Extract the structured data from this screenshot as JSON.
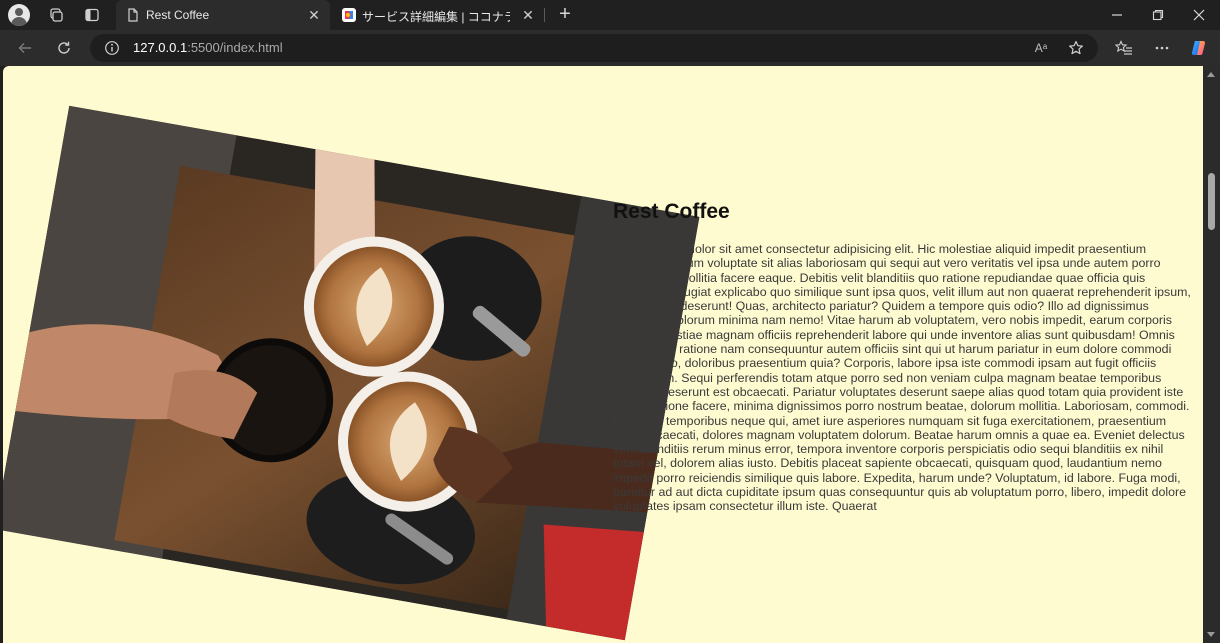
{
  "tabs": [
    {
      "title": "Rest Coffee",
      "active": true
    },
    {
      "title": "サービス詳細編集 | ココナラ",
      "active": false
    }
  ],
  "address_bar": {
    "host": "127.0.0.1",
    "path": ":5500/index.html",
    "read_aloud_label": "Aᵃ"
  },
  "page": {
    "heading": "Rest Coffee",
    "body": "Lorem ipsum dolor sit amet consectetur adipisicing elit. Hic molestiae aliquid impedit praesentium voluptatum, cum voluptate sit alias laboriosam qui sequi aut vero veritatis vel ipsa unde autem porro quam quod mollitia facere eaque. Debitis velit blanditiis quo ratione repudiandae quae officia quis laboriosam, fugiat explicabo quo similique sunt ipsa quos, velit illum aut non quaerat reprehenderit ipsum, consectetur deserunt! Quas, architecto pariatur? Quidem a tempore quis odio? Illo ad dignissimus architecto dolorum minima nam nemo! Vitae harum ab voluptatem, vero nobis impedit, earum corporis ipsam molestiae magnam officiis reprehenderit labore qui unde inventore alias sunt quibusdam! Omnis accusamus ratione nam consequuntur autem officiis sint qui ut harum pariatur in eum dolore commodi labore optio, doloribus praesentium quia? Corporis, labore ipsa iste commodi ipsam aut fugit officiis deserunt in. Sequi perferendis totam atque porro sed non veniam culpa magnam beatae temporibus adipisci, deserunt est obcaecati. Pariatur voluptates deserunt saepe alias quod totam quia provident iste neque ratione facere, minima dignissimos porro nostrum beatae, dolorum mollitia. Laboriosam, commodi. Blanditiis temporibus neque qui, amet iure asperiores numquam sit fuga exercitationem, praesentium nulla obcaecati, dolores magnam voluptatem dolorum. Beatae harum omnis a quae ea. Eveniet delectus vero blanditiis rerum minus error, tempora inventore corporis perspiciatis odio sequi blanditiis ex nihil totam vel, dolorem alias iusto. Debitis placeat sapiente obcaecati, quisquam quod, laudantium nemo impedit porro reiciendis similique quis labore. Expedita, harum unde? Voluptatum, id labore. Fuga modi, pariatur ad aut dicta cupiditate ipsum quas consequuntur quis ab voluptatum porro, libero, impedit dolore voluptates ipsam consectetur illum iste. Quaerat"
  },
  "colors": {
    "page_background": "#fffbd0",
    "browser_chrome": "#202020",
    "toolbar": "#2c2c2c"
  }
}
